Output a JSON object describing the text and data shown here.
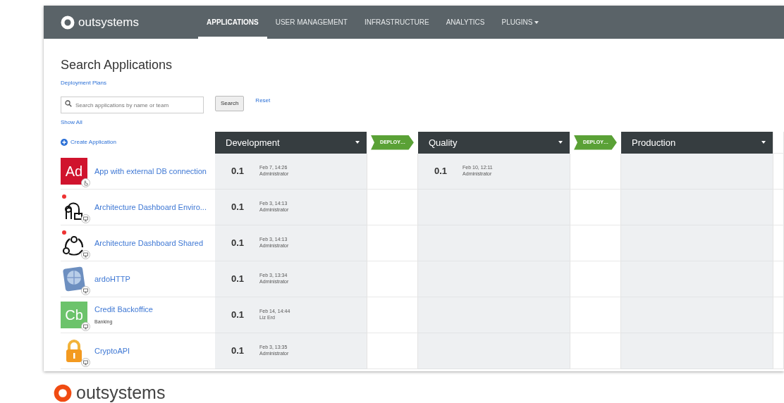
{
  "navbar": {
    "brand": "outsystems",
    "items": [
      {
        "label": "APPLICATIONS",
        "selected": true,
        "has_menu": false
      },
      {
        "label": "USER MANAGEMENT",
        "selected": false,
        "has_menu": false
      },
      {
        "label": "INFRASTRUCTURE",
        "selected": false,
        "has_menu": false
      },
      {
        "label": "ANALYTICS",
        "selected": false,
        "has_menu": false
      },
      {
        "label": "PLUGINS",
        "selected": false,
        "has_menu": true
      }
    ]
  },
  "page": {
    "title": "Search Applications",
    "subtitle_link": "Deployment Plans",
    "search": {
      "placeholder": "Search applications by name or team"
    },
    "search_button": "Search",
    "reset_link": "Reset",
    "show_all_link": "Show All",
    "create_link": "Create Application"
  },
  "environments": [
    {
      "name": "Development"
    },
    {
      "name": "Quality"
    },
    {
      "name": "Production"
    }
  ],
  "deploy_buttons": [
    "DEPLOY…",
    "DEPLOY…"
  ],
  "applications": [
    {
      "name": "App with external DB connection",
      "icon": {
        "kind": "initials",
        "text": "Ad",
        "color": "#d0132d"
      },
      "kind": "mobile",
      "development": {
        "version": "0.1",
        "date": "Feb 7, 14:26",
        "user": "Administrator"
      },
      "quality": {
        "version": "0.1",
        "date": "Feb 10, 12:11",
        "user": "Administrator"
      }
    },
    {
      "name": "Architecture Dashboard Enviro...",
      "icon": {
        "kind": "probe"
      },
      "kind": "web",
      "development": {
        "version": "0.1",
        "date": "Feb 3, 14:13",
        "user": "Administrator"
      }
    },
    {
      "name": "Architecture Dashboard Shared",
      "icon": {
        "kind": "network"
      },
      "kind": "web",
      "development": {
        "version": "0.1",
        "date": "Feb 3, 14:13",
        "user": "Administrator"
      }
    },
    {
      "name": "ardoHTTP",
      "icon": {
        "kind": "globe"
      },
      "kind": "web",
      "development": {
        "version": "0.1",
        "date": "Feb 3, 13:34",
        "user": "Administrator"
      }
    },
    {
      "name": "Credit Backoffice",
      "team": "Banking",
      "icon": {
        "kind": "initials",
        "text": "Cb",
        "color": "#6cc36b"
      },
      "kind": "web",
      "development": {
        "version": "0.1",
        "date": "Feb 14, 14:44",
        "user": "Liz Erd"
      }
    },
    {
      "name": "CryptoAPI",
      "icon": {
        "kind": "padlock"
      },
      "kind": "web",
      "development": {
        "version": "0.1",
        "date": "Feb 3, 13:35",
        "user": "Administrator"
      }
    }
  ],
  "footer": {
    "brand": "outsystems"
  }
}
